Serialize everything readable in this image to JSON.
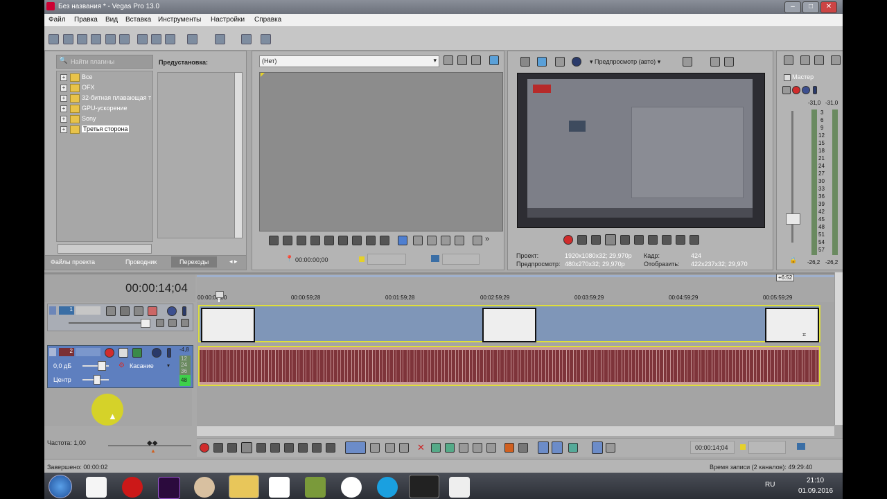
{
  "window": {
    "title": "Без названия * - Vegas Pro 13.0"
  },
  "menu": [
    "Файл",
    "Правка",
    "Вид",
    "Вставка",
    "Инструменты",
    "Настройки",
    "Справка"
  ],
  "explorer": {
    "search_placeholder": "Найти плагины",
    "items": [
      "Все",
      "OFX",
      "32-битная плавающая т",
      "GPU-ускорение",
      "Sony",
      "Третья сторона"
    ],
    "presets_label": "Предустановка:",
    "tabs": [
      "Файлы проекта",
      "Проводник",
      "Переходы"
    ]
  },
  "trimmer": {
    "dropdown": "(Нет)",
    "timecode": "00:00:00;00"
  },
  "preview": {
    "mode": "Предпросмотр (авто)",
    "project_label": "Проект:",
    "project_value": "1920x1080x32; 29,970p",
    "preview_label": "Предпросмотр:",
    "preview_value": "480x270x32; 29,970p",
    "frame_label": "Кадр:",
    "frame_value": "424",
    "display_label": "Отобразить:",
    "display_value": "422x237x32; 29,970"
  },
  "master": {
    "label": "Мастер",
    "peak_left": "-31,0",
    "peak_right": "-31,0",
    "scale": [
      "3",
      "6",
      "9",
      "12",
      "15",
      "18",
      "21",
      "24",
      "27",
      "30",
      "33",
      "36",
      "39",
      "42",
      "45",
      "48",
      "51",
      "54",
      "57"
    ],
    "bottom_left": "-26,2",
    "bottom_right": "-26,2"
  },
  "timeline": {
    "timecode": "00:00:14;04",
    "ruler": [
      "00:00:00;00",
      "00:00:59;28",
      "00:01:59;28",
      "00:02:59;29",
      "00:03:59;29",
      "00:04:59;29",
      "00:05:59;29"
    ],
    "ruler_badge": "+6:52",
    "video_track_no": "1",
    "audio_track_no": "2",
    "audio_volume": "0,0 дБ",
    "audio_mode": "Касание",
    "audio_pan": "Центр",
    "audio_level": "-4,8",
    "meter_ticks": [
      "12",
      "24",
      "36",
      "48"
    ],
    "rate": "Частота: 1,00",
    "transport_timecode": "00:00:14;04"
  },
  "status": {
    "left": "Завершено: 00:00:02",
    "right": "Время записи (2 каналов): 49:29:40"
  },
  "taskbar": {
    "lang": "RU",
    "time": "21:10",
    "date": "01.09.2016"
  },
  "colors": {
    "accent": "#3a6ea5",
    "video_clip": "#7f96b8",
    "audio_clip": "#c99a9a",
    "audio_wave": "#7a2f35",
    "video_header": "#6c86b8",
    "audio_header": "#5e7fbf"
  }
}
